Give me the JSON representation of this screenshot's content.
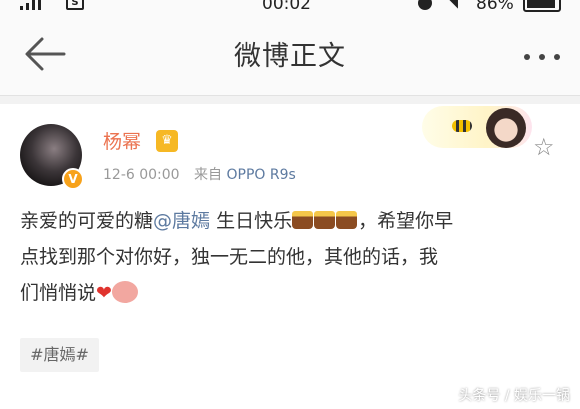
{
  "status_bar": {
    "time": "00:02",
    "battery": "86%"
  },
  "nav": {
    "title": "微博正文"
  },
  "post": {
    "username": "杨幂",
    "time": "12-6 00:00",
    "source_prefix": "来自",
    "source": "OPPO R9s",
    "text_line1_a": "亲爱的可爱的糖",
    "mention": "@唐嫣",
    "text_line1_b": " 生日快乐",
    "text_line1_c": "，希望你早",
    "text_line2": "点找到那个对你好，独一无二的他，其他的话，我",
    "text_line3": "们悄悄说",
    "heart": "❤",
    "topic": "#唐嫣#"
  },
  "watermark": "头条号 / 娱乐一锅",
  "colors": {
    "username": "#eb7350",
    "link": "#5d7aa0",
    "verify": "#f7a21b"
  },
  "icons": [
    "signal-icon",
    "sim-icon",
    "alarm-icon",
    "wifi-icon",
    "battery-icon",
    "back-arrow-icon",
    "more-icon",
    "star-icon",
    "crown-icon",
    "verified-icon",
    "cake-emoji",
    "heart-emoji",
    "pig-sticker"
  ]
}
